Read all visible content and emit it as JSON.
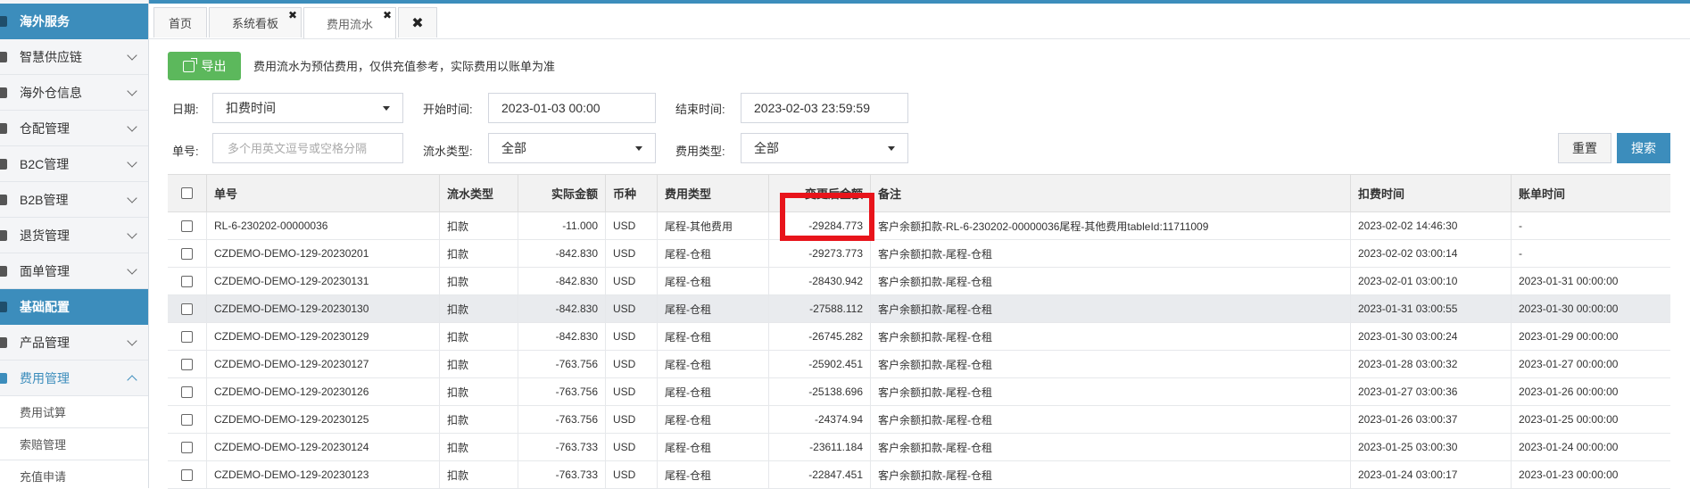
{
  "sidebar": {
    "items": [
      {
        "label": "海外服务",
        "kind": "section"
      },
      {
        "label": "智慧供应链",
        "kind": "menu"
      },
      {
        "label": "海外仓信息",
        "kind": "menu"
      },
      {
        "label": "仓配管理",
        "kind": "menu"
      },
      {
        "label": "B2C管理",
        "kind": "menu"
      },
      {
        "label": "B2B管理",
        "kind": "menu"
      },
      {
        "label": "退货管理",
        "kind": "menu"
      },
      {
        "label": "面单管理",
        "kind": "menu"
      },
      {
        "label": "基础配置",
        "kind": "section"
      },
      {
        "label": "产品管理",
        "kind": "menu"
      },
      {
        "label": "费用管理",
        "kind": "open"
      }
    ],
    "subitems": [
      {
        "label": "费用试算"
      },
      {
        "label": "索赔管理"
      },
      {
        "label": "充值申请"
      }
    ]
  },
  "tabs": [
    {
      "label": "首页"
    },
    {
      "label": "系统看板"
    },
    {
      "label": "费用流水"
    }
  ],
  "toolbar": {
    "export_label": "导出",
    "notice": "费用流水为预估费用，仅供充值参考，实际费用以账单为准"
  },
  "filters": {
    "date_label": "日期:",
    "date_value": "扣费时间",
    "start_label": "开始时间:",
    "start_value": "2023-01-03 00:00",
    "end_label": "结束时间:",
    "end_value": "2023-02-03 23:59:59",
    "no_label": "单号:",
    "no_placeholder": "多个用英文逗号或空格分隔",
    "flow_label": "流水类型:",
    "flow_value": "全部",
    "fee_label": "费用类型:",
    "fee_value": "全部",
    "reset_label": "重置",
    "search_label": "搜索"
  },
  "table": {
    "headers": [
      "单号",
      "流水类型",
      "实际金额",
      "币种",
      "费用类型",
      "变更后金额",
      "备注",
      "扣费时间",
      "账单时间"
    ],
    "rows": [
      [
        "RL-6-230202-00000036",
        "扣款",
        "-11.000",
        "USD",
        "尾程-其他费用",
        "-29284.773",
        "客户余额扣款-RL-6-230202-00000036尾程-其他费用tableId:11711009",
        "2023-02-02 14:46:30",
        "-"
      ],
      [
        "CZDEMO-DEMO-129-20230201",
        "扣款",
        "-842.830",
        "USD",
        "尾程-仓租",
        "-29273.773",
        "客户余额扣款-尾程-仓租",
        "2023-02-02 03:00:14",
        "-"
      ],
      [
        "CZDEMO-DEMO-129-20230131",
        "扣款",
        "-842.830",
        "USD",
        "尾程-仓租",
        "-28430.942",
        "客户余额扣款-尾程-仓租",
        "2023-02-01 03:00:10",
        "2023-01-31 00:00:00"
      ],
      [
        "CZDEMO-DEMO-129-20230130",
        "扣款",
        "-842.830",
        "USD",
        "尾程-仓租",
        "-27588.112",
        "客户余额扣款-尾程-仓租",
        "2023-01-31 03:00:55",
        "2023-01-30 00:00:00"
      ],
      [
        "CZDEMO-DEMO-129-20230129",
        "扣款",
        "-842.830",
        "USD",
        "尾程-仓租",
        "-26745.282",
        "客户余额扣款-尾程-仓租",
        "2023-01-30 03:00:24",
        "2023-01-29 00:00:00"
      ],
      [
        "CZDEMO-DEMO-129-20230127",
        "扣款",
        "-763.756",
        "USD",
        "尾程-仓租",
        "-25902.451",
        "客户余额扣款-尾程-仓租",
        "2023-01-28 03:00:32",
        "2023-01-27 00:00:00"
      ],
      [
        "CZDEMO-DEMO-129-20230126",
        "扣款",
        "-763.756",
        "USD",
        "尾程-仓租",
        "-25138.696",
        "客户余额扣款-尾程-仓租",
        "2023-01-27 03:00:36",
        "2023-01-26 00:00:00"
      ],
      [
        "CZDEMO-DEMO-129-20230125",
        "扣款",
        "-763.756",
        "USD",
        "尾程-仓租",
        "-24374.94",
        "客户余额扣款-尾程-仓租",
        "2023-01-26 03:00:37",
        "2023-01-25 00:00:00"
      ],
      [
        "CZDEMO-DEMO-129-20230124",
        "扣款",
        "-763.733",
        "USD",
        "尾程-仓租",
        "-23611.184",
        "客户余额扣款-尾程-仓租",
        "2023-01-25 03:00:30",
        "2023-01-24 00:00:00"
      ],
      [
        "CZDEMO-DEMO-129-20230123",
        "扣款",
        "-763.733",
        "USD",
        "尾程-仓租",
        "-22847.451",
        "客户余额扣款-尾程-仓租",
        "2023-01-24 03:00:17",
        "2023-01-23 00:00:00"
      ]
    ]
  },
  "colors": {
    "accent": "#3c8dbc",
    "export_green": "#5cb85c",
    "highlight_red": "#e8141b"
  }
}
